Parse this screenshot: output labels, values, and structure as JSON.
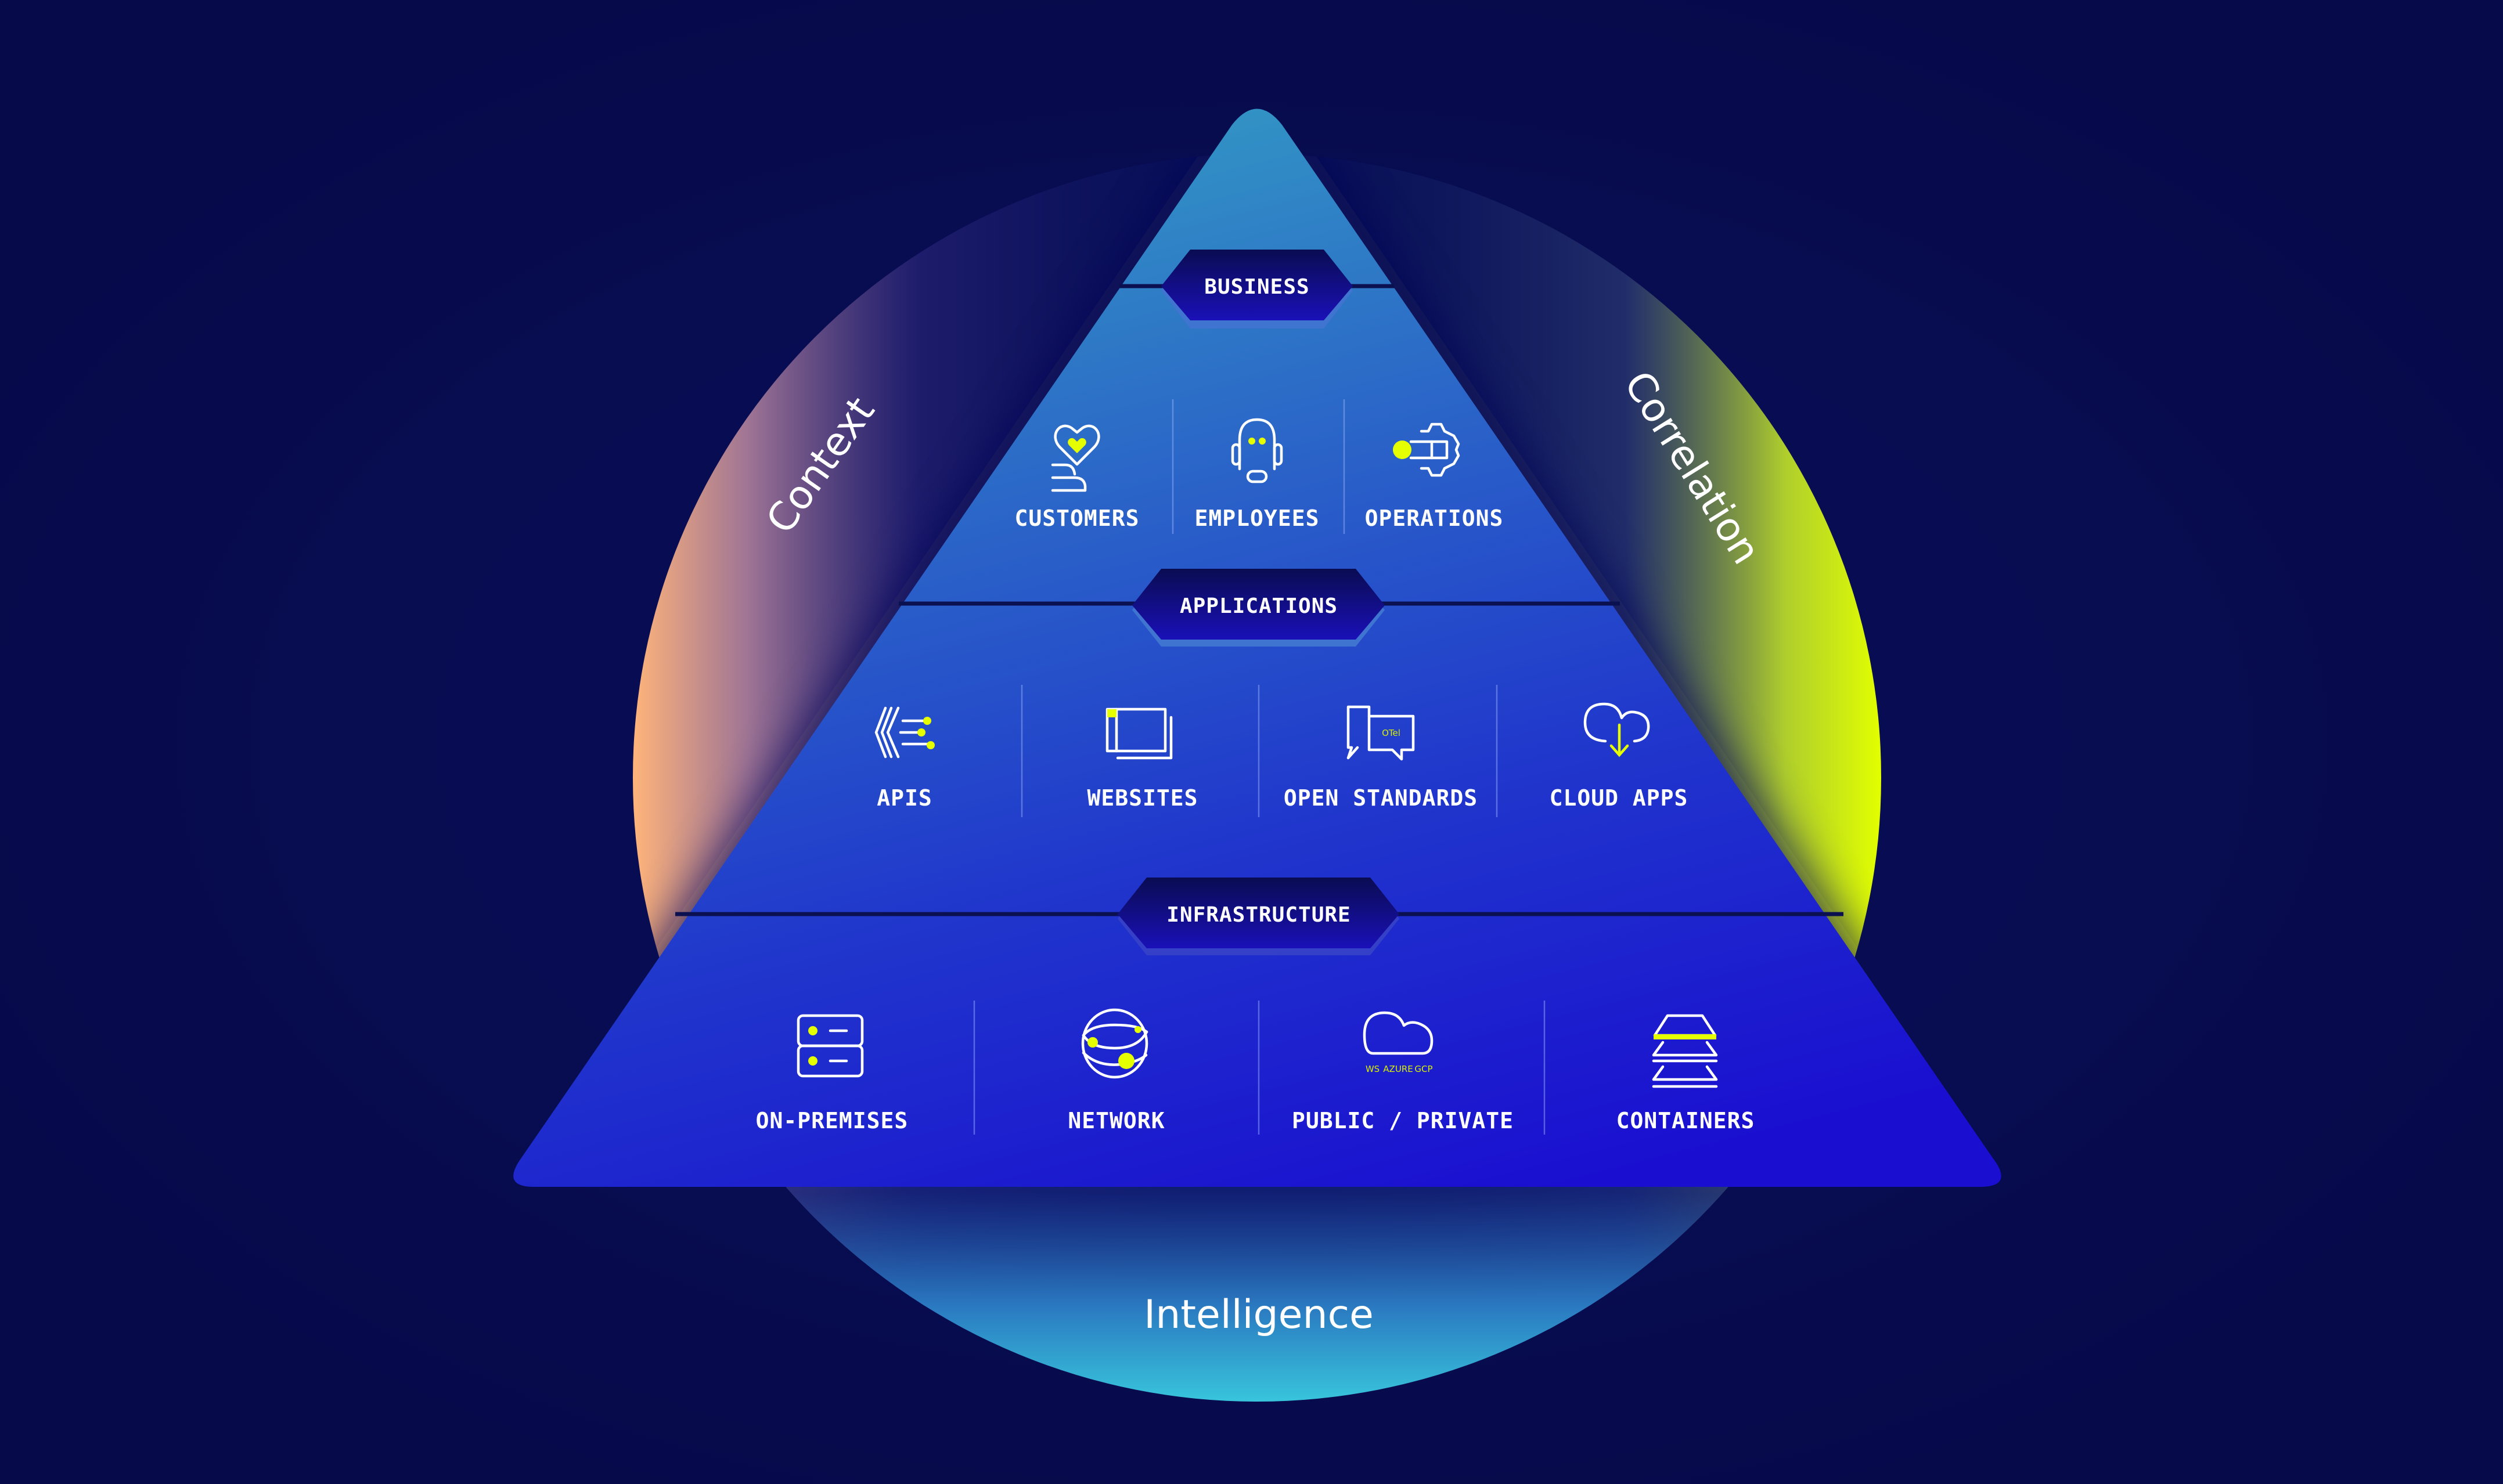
{
  "colors": {
    "background": "#060a4a",
    "pyramid_top": "#2f95c4",
    "pyramid_bottom": "#1a0fd0",
    "badge": "#0c0d68",
    "accent": "#e5ff00",
    "context_glow": "#ffb47a",
    "correlation_glow": "#e2ff00",
    "intelligence_glow": "#3ad0e0"
  },
  "arcs": {
    "left": {
      "label": "Context"
    },
    "right": {
      "label": "Correlation"
    },
    "bottom": {
      "label": "Intelligence"
    }
  },
  "layers": [
    {
      "name": "BUSINESS",
      "items": [
        {
          "label": "CUSTOMERS",
          "icon": "heart-in-hand-icon"
        },
        {
          "label": "EMPLOYEES",
          "icon": "headset-agent-icon"
        },
        {
          "label": "OPERATIONS",
          "icon": "gear-workflow-icon"
        }
      ]
    },
    {
      "name": "APPLICATIONS",
      "items": [
        {
          "label": "APIS",
          "icon": "api-connector-icon"
        },
        {
          "label": "WEBSITES",
          "icon": "browser-windows-icon"
        },
        {
          "label": "OPEN STANDARDS",
          "icon": "chat-bubbles-icon",
          "icon_text": "OTel"
        },
        {
          "label": "CLOUD APPS",
          "icon": "cloud-download-icon"
        }
      ]
    },
    {
      "name": "INFRASTRUCTURE",
      "items": [
        {
          "label": "ON-PREMISES",
          "icon": "server-rack-icon"
        },
        {
          "label": "NETWORK",
          "icon": "globe-network-icon"
        },
        {
          "label": "PUBLIC / PRIVATE",
          "icon": "cloud-providers-icon",
          "icon_text": [
            "WS",
            "AZURE",
            "GCP"
          ]
        },
        {
          "label": "CONTAINERS",
          "icon": "container-stack-icon"
        }
      ]
    }
  ]
}
